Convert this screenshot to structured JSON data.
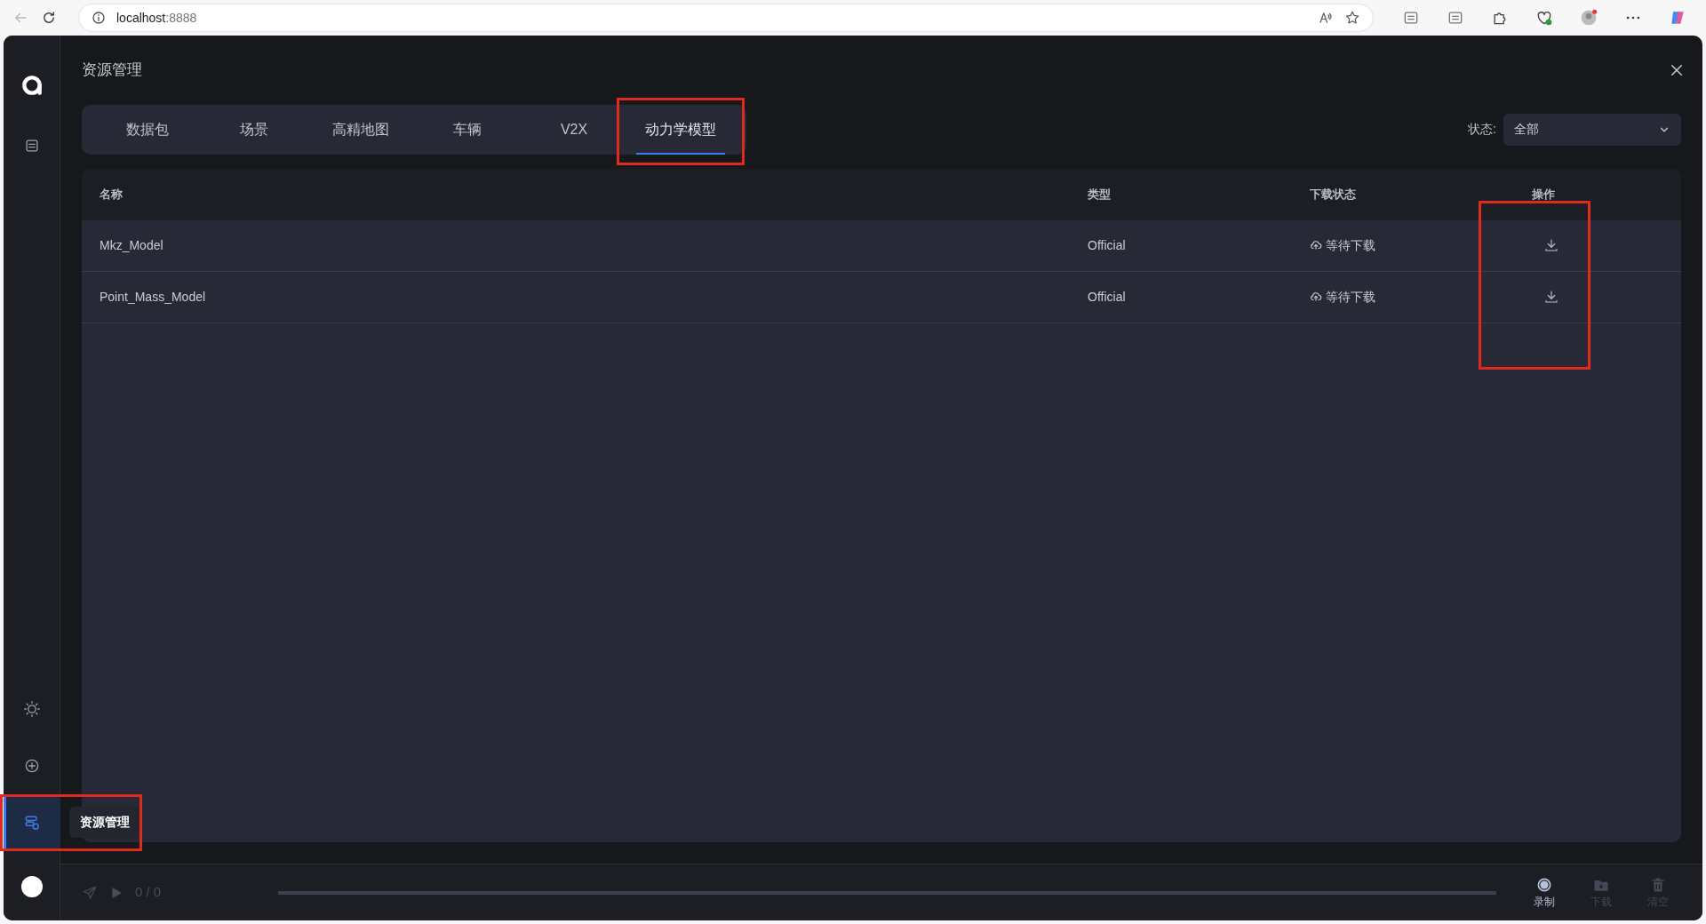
{
  "browser": {
    "host": "localhost",
    "port": ":8888"
  },
  "sidebar": {
    "top_items": [
      {
        "kind": "logo"
      },
      {
        "kind": "sliders",
        "selected": false
      }
    ],
    "bottom_items": [
      {
        "kind": "sun",
        "selected": false,
        "highlighted": false
      },
      {
        "kind": "plus",
        "selected": false,
        "highlighted": false
      },
      {
        "kind": "resources",
        "selected": true,
        "highlighted": true,
        "tooltip": "资源管理"
      }
    ]
  },
  "panel": {
    "title": "资源管理",
    "tabs": [
      {
        "label": "数据包",
        "selected": false,
        "highlighted": false
      },
      {
        "label": "场景",
        "selected": false,
        "highlighted": false
      },
      {
        "label": "高精地图",
        "selected": false,
        "highlighted": false
      },
      {
        "label": "车辆",
        "selected": false,
        "highlighted": false
      },
      {
        "label": "V2X",
        "selected": false,
        "highlighted": false
      },
      {
        "label": "动力学模型",
        "selected": true,
        "highlighted": true
      }
    ],
    "filter": {
      "label": "状态:",
      "value": "全部"
    },
    "table": {
      "columns": [
        {
          "label": "名称",
          "highlighted": false
        },
        {
          "label": "类型",
          "highlighted": false
        },
        {
          "label": "下载状态",
          "highlighted": false
        },
        {
          "label": "操作",
          "highlighted": true
        }
      ],
      "rows": [
        {
          "name": "Mkz_Model",
          "type": "Official",
          "status": "等待下载"
        },
        {
          "name": "Point_Mass_Model",
          "type": "Official",
          "status": "等待下载"
        }
      ]
    }
  },
  "player": {
    "counter": "0 / 0",
    "actions": [
      {
        "kind": "record",
        "label": "录制",
        "disabled": false
      },
      {
        "kind": "download",
        "label": "下载",
        "disabled": true
      },
      {
        "kind": "clear",
        "label": "清空",
        "disabled": true
      }
    ]
  }
}
